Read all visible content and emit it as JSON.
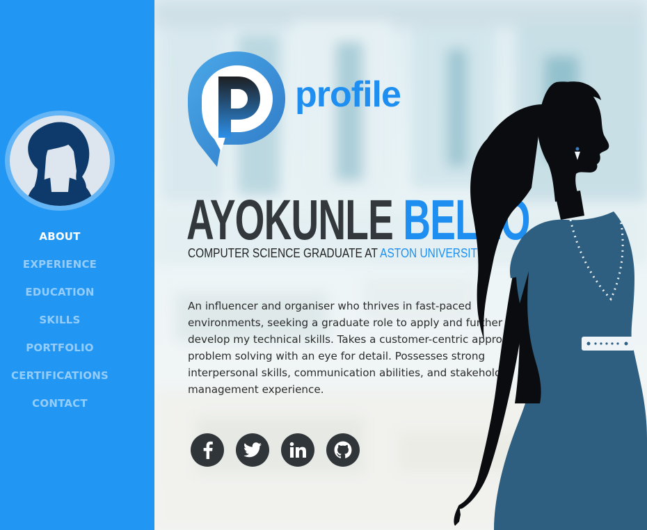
{
  "sidebar": {
    "nav": [
      {
        "label": "ABOUT",
        "active": true
      },
      {
        "label": "EXPERIENCE",
        "active": false
      },
      {
        "label": "EDUCATION",
        "active": false
      },
      {
        "label": "SKILLS",
        "active": false
      },
      {
        "label": "PORTFOLIO",
        "active": false
      },
      {
        "label": "CERTIFICATIONS",
        "active": false
      },
      {
        "label": "CONTACT",
        "active": false
      }
    ]
  },
  "logo": {
    "word": "profile"
  },
  "hero": {
    "first_name": "AYOKUNLE",
    "last_name": "BELLO",
    "subtitle_prefix": "COMPUTER SCIENCE GRADUATE AT",
    "subtitle_university": "ASTON UNIVERSITY",
    "summary": "An influencer and organiser who thrives in fast-paced environments, seeking a graduate role to apply and further develop my technical skills. Takes a customer-centric approach to problem solving with an eye for detail. Possesses strong interpersonal skills, communication abilities, and stakeholder management experience."
  },
  "socials": [
    {
      "icon": "facebook-icon"
    },
    {
      "icon": "twitter-icon"
    },
    {
      "icon": "linkedin-icon"
    },
    {
      "icon": "github-icon"
    }
  ],
  "colors": {
    "accent": "#2196f3",
    "name_dark": "#33383c",
    "icon_bg": "#2f3539"
  }
}
